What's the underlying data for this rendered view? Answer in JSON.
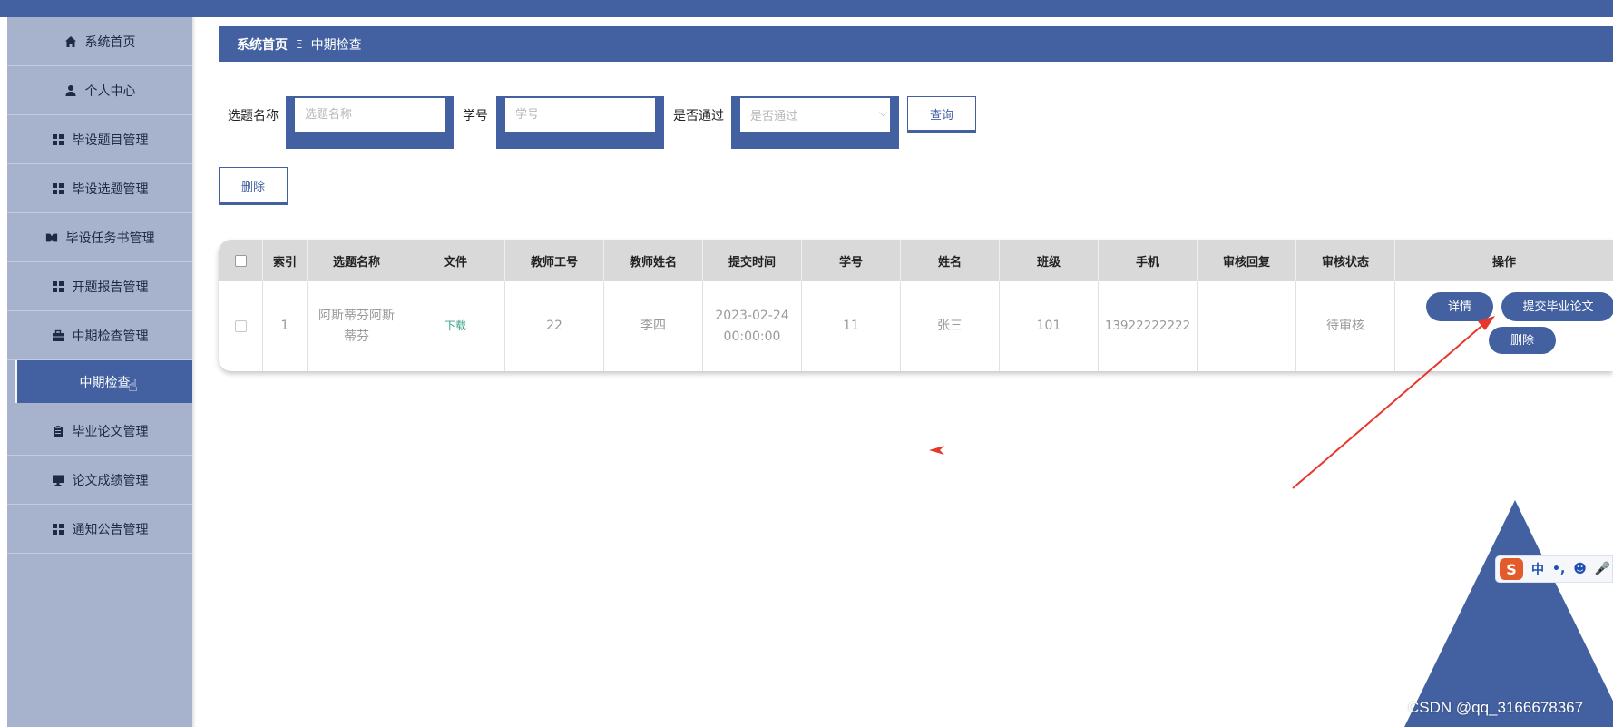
{
  "sidebar": {
    "items": [
      {
        "label": "系统首页",
        "icon": "home-icon"
      },
      {
        "label": "个人中心",
        "icon": "user-icon"
      },
      {
        "label": "毕设题目管理",
        "icon": "grid-icon"
      },
      {
        "label": "毕设选题管理",
        "icon": "grid-icon"
      },
      {
        "label": "毕设任务书管理",
        "icon": "ticket-icon"
      },
      {
        "label": "开题报告管理",
        "icon": "grid-icon"
      },
      {
        "label": "中期检查管理",
        "icon": "briefcase-icon"
      },
      {
        "label": "中期检查",
        "icon": "",
        "active": true
      },
      {
        "label": "毕业论文管理",
        "icon": "clipboard-icon"
      },
      {
        "label": "论文成绩管理",
        "icon": "monitor-icon"
      },
      {
        "label": "通知公告管理",
        "icon": "grid-icon"
      }
    ]
  },
  "breadcrumb": {
    "home": "系统首页",
    "separator": "Ξ",
    "current": "中期检查"
  },
  "search": {
    "title_label": "选题名称",
    "title_placeholder": "选题名称",
    "student_label": "学号",
    "student_placeholder": "学号",
    "pass_label": "是否通过",
    "pass_placeholder": "是否通过",
    "query_button": "查询"
  },
  "actions": {
    "delete_button": "删除"
  },
  "table": {
    "columns": [
      "索引",
      "选题名称",
      "文件",
      "教师工号",
      "教师姓名",
      "提交时间",
      "学号",
      "姓名",
      "班级",
      "手机",
      "审核回复",
      "审核状态",
      "操作"
    ],
    "rows": [
      {
        "index": "1",
        "title": "阿斯蒂芬阿斯蒂芬",
        "file": "下载",
        "teacher_id": "22",
        "teacher_name": "李四",
        "submit_time": "2023-02-24 00:00:00",
        "student_id": "11",
        "name": "张三",
        "class": "101",
        "phone": "13922222222",
        "review_reply": "",
        "review_status": "待审核",
        "ops": {
          "detail": "详情",
          "submit": "提交毕业论文",
          "delete": "删除"
        }
      }
    ]
  },
  "ime": {
    "label": "中"
  },
  "watermark": "CSDN @qq_3166678367",
  "colors": {
    "primary": "#4361a1",
    "sidebar": "#a7b3cc",
    "header_bg": "#d9d9d9",
    "annotation": "#e8362b"
  }
}
